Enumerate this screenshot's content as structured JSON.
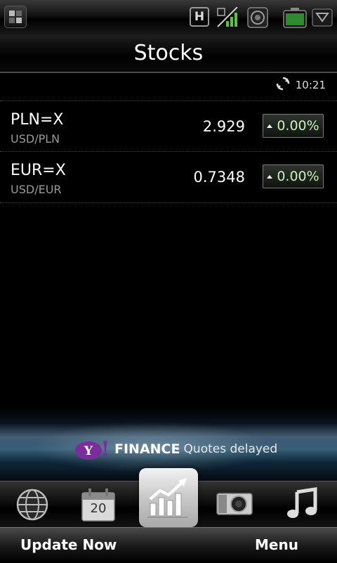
{
  "status_bar": {
    "network_letter": "H",
    "icons": [
      "menu-grid-icon",
      "hsdpa-icon",
      "signal-strength-icon",
      "camera-icon",
      "battery-icon",
      "dropdown-arrow-icon"
    ]
  },
  "header": {
    "title": "Stocks"
  },
  "update": {
    "time": "10:21"
  },
  "quotes": [
    {
      "symbol": "PLN=X",
      "pair": "USD/PLN",
      "price": "2.929",
      "change": "0.00%"
    },
    {
      "symbol": "EUR=X",
      "pair": "USD/EUR",
      "price": "0.7348",
      "change": "0.00%"
    }
  ],
  "banner": {
    "finance": "FINANCE",
    "note": "- Quotes delayed"
  },
  "dock": {
    "calendar_day": "20",
    "items": [
      "globe-icon",
      "calendar-icon",
      "stocks-chart-icon",
      "camera-app-icon",
      "music-icon"
    ]
  },
  "softkeys": {
    "left": "Update Now",
    "right": "Menu"
  },
  "colors": {
    "change_text": "#c9f0b8",
    "yahoo_purple": "#7b2d9e"
  }
}
